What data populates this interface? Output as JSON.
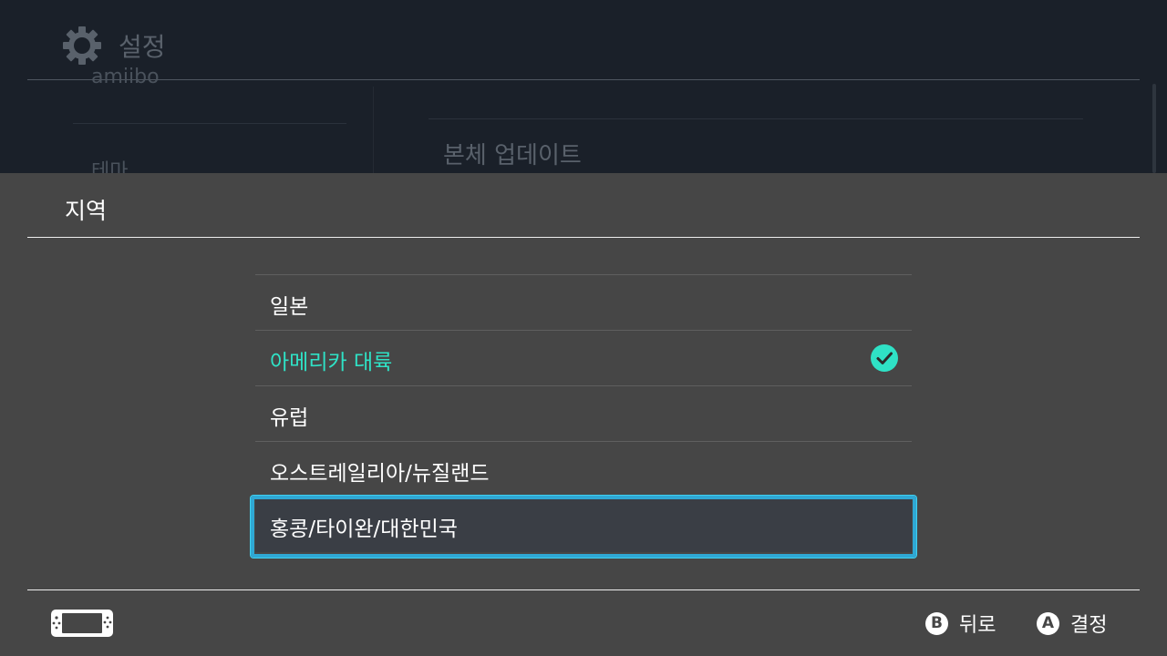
{
  "background": {
    "header_title": "설정",
    "sidebar_items": [
      "amiibo",
      "테마"
    ],
    "main_item": "본체 업데이트"
  },
  "panel": {
    "title": "지역",
    "regions": [
      {
        "label": "일본",
        "selected": false,
        "focused": false
      },
      {
        "label": "아메리카 대륙",
        "selected": true,
        "focused": false
      },
      {
        "label": "유럽",
        "selected": false,
        "focused": false
      },
      {
        "label": "오스트레일리아/뉴질랜드",
        "selected": false,
        "focused": false
      },
      {
        "label": "홍콩/타이완/대한민국",
        "selected": false,
        "focused": true
      }
    ]
  },
  "footer": {
    "back": {
      "glyph": "B",
      "label": "뒤로"
    },
    "ok": {
      "glyph": "A",
      "label": "결정"
    }
  },
  "colors": {
    "selected_text": "#2fe2c6",
    "focus_border": "#2fa8d4",
    "panel_bg": "#464646"
  },
  "icons": {
    "header": "gear-icon",
    "selected_mark": "checkmark-circle-icon",
    "console": "handheld-console-icon"
  }
}
